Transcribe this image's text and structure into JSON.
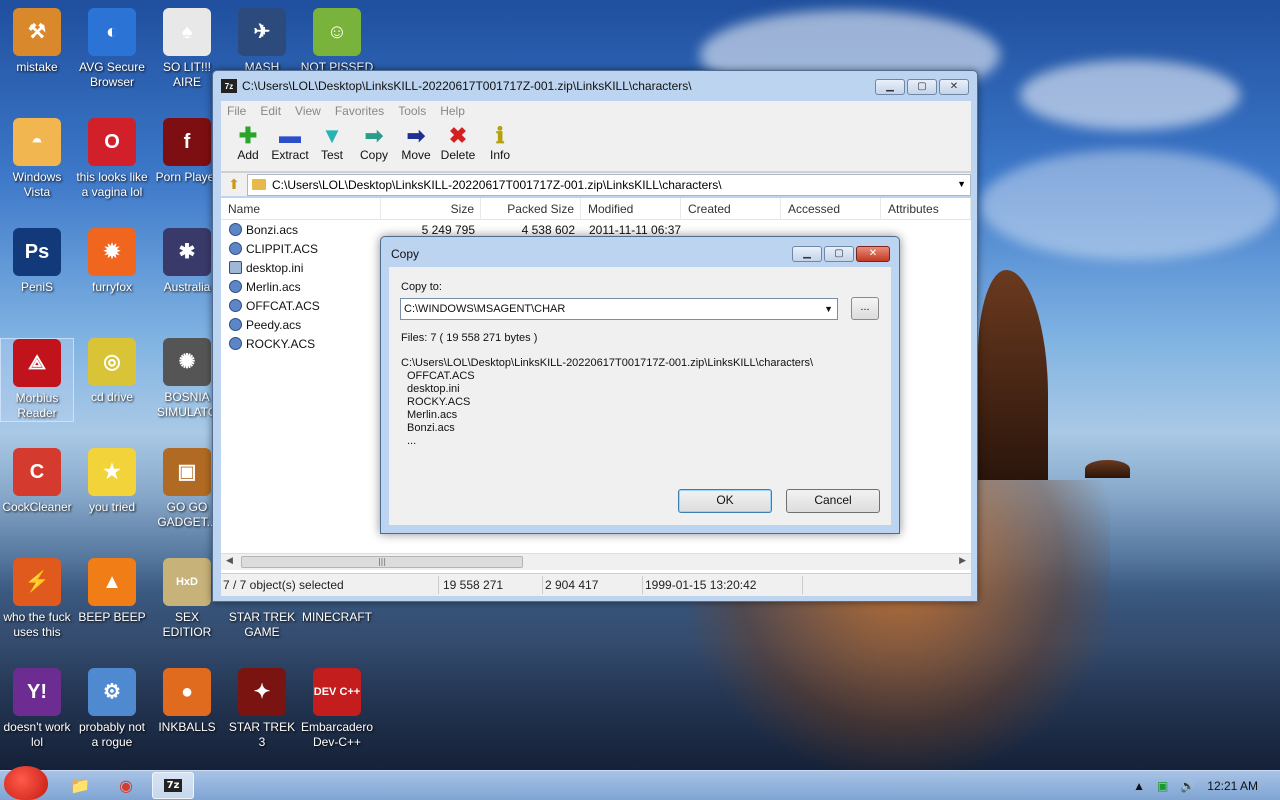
{
  "desktop": {
    "icons": [
      {
        "label": "mistake",
        "glyph": "⚒",
        "color": "#d9892c"
      },
      {
        "label": "AVG Secure Browser",
        "glyph": "◐",
        "color": "#2b74d6"
      },
      {
        "label": "SO LIT!!! AIRE",
        "glyph": "♠",
        "color": "#e8e8e8"
      },
      {
        "label": "MASH",
        "glyph": "✈",
        "color": "#2c4a7c"
      },
      {
        "label": "NOT PISSED",
        "glyph": "☺",
        "color": "#79b33b"
      },
      {
        "label": "Windows Vista",
        "glyph": "◓",
        "color": "#f2b650"
      },
      {
        "label": "this looks like a vagina lol",
        "glyph": "O",
        "color": "#d1202a"
      },
      {
        "label": "Porn Player",
        "glyph": "f",
        "color": "#7d0f12"
      },
      {
        "label": "PeniS",
        "glyph": "Ps",
        "color": "#123a7a"
      },
      {
        "label": "furryfox",
        "glyph": "✹",
        "color": "#f0661e"
      },
      {
        "label": "Australia",
        "glyph": "✱",
        "color": "#3a3a6a"
      },
      {
        "label": "Morbius Reader",
        "glyph": "⟁",
        "color": "#c0131b"
      },
      {
        "label": "cd drive",
        "glyph": "◎",
        "color": "#d9c437"
      },
      {
        "label": "BOSNIA SIMULATO",
        "glyph": "✺",
        "color": "#555"
      },
      {
        "label": "CockCleaner",
        "glyph": "C",
        "color": "#d53a2e"
      },
      {
        "label": "you tried",
        "glyph": "★",
        "color": "#f2d33a"
      },
      {
        "label": "GO GO GADGET...",
        "glyph": "▣",
        "color": "#b06a23"
      },
      {
        "label": "who the fuck uses this",
        "glyph": "⚡",
        "color": "#e05a1e"
      },
      {
        "label": "BEEP BEEP",
        "glyph": "▲",
        "color": "#f07d16"
      },
      {
        "label": "SEX EDITIOR",
        "glyph": "HxD",
        "color": "#c7b27a"
      },
      {
        "label": "STAR TREK GAME",
        "glyph": "",
        "color": "transparent"
      },
      {
        "label": "MINECRAFT",
        "glyph": "",
        "color": "transparent"
      },
      {
        "label": "doesn't work lol",
        "glyph": "Y!",
        "color": "#6c2c91"
      },
      {
        "label": "probably not a rogue",
        "glyph": "⚙",
        "color": "#4f8ad0"
      },
      {
        "label": "INKBALLS",
        "glyph": "●",
        "color": "#e06a1e"
      },
      {
        "label": "STAR TREK 3",
        "glyph": "✦",
        "color": "#7a1410"
      },
      {
        "label": "Embarcadero Dev-C++",
        "glyph": "DEV C++",
        "color": "#c41d1d"
      }
    ]
  },
  "zipwin": {
    "title": "C:\\Users\\LOL\\Desktop\\LinksKILL-20220617T001717Z-001.zip\\LinksKILL\\characters\\",
    "logo": "7z",
    "menu": [
      "File",
      "Edit",
      "View",
      "Favorites",
      "Tools",
      "Help"
    ],
    "toolbar": [
      {
        "label": "Add",
        "glyph": "✚",
        "color": "#2aa52a"
      },
      {
        "label": "Extract",
        "glyph": "▬",
        "color": "#2a4fc9"
      },
      {
        "label": "Test",
        "glyph": "▼",
        "color": "#2ab3b3"
      },
      {
        "label": "Copy",
        "glyph": "➡",
        "color": "#2a9d8a"
      },
      {
        "label": "Move",
        "glyph": "➡",
        "color": "#1f2f8f"
      },
      {
        "label": "Delete",
        "glyph": "✖",
        "color": "#d42020"
      },
      {
        "label": "Info",
        "glyph": "ℹ",
        "color": "#b3a20c"
      }
    ],
    "address": "C:\\Users\\LOL\\Desktop\\LinksKILL-20220617T001717Z-001.zip\\LinksKILL\\characters\\",
    "columns": [
      "Name",
      "Size",
      "Packed Size",
      "Modified",
      "Created",
      "Accessed",
      "Attributes"
    ],
    "files": [
      {
        "name": "Bonzi.acs",
        "size": "5 249 795",
        "packed": "4 538 602",
        "modified": "2011-11-11 06:37",
        "type": "acs"
      },
      {
        "name": "CLIPPIT.ACS",
        "size": "",
        "packed": "",
        "modified": "",
        "type": "acs"
      },
      {
        "name": "desktop.ini",
        "size": "",
        "packed": "",
        "modified": "",
        "type": "ini"
      },
      {
        "name": "Merlin.acs",
        "size": "",
        "packed": "",
        "modified": "",
        "type": "acs"
      },
      {
        "name": "OFFCAT.ACS",
        "size": "",
        "packed": "",
        "modified": "",
        "type": "acs"
      },
      {
        "name": "Peedy.acs",
        "size": "",
        "packed": "",
        "modified": "",
        "type": "acs"
      },
      {
        "name": "ROCKY.ACS",
        "size": "",
        "packed": "",
        "modified": "",
        "type": "acs"
      }
    ],
    "status": {
      "selected": "7 / 7 object(s) selected",
      "size": "19 558 271",
      "packed": "2 904 417",
      "date": "1999-01-15 13:20:42"
    }
  },
  "dialog": {
    "title": "Copy",
    "copy_to_label": "Copy to:",
    "copy_to_value": "C:\\WINDOWS\\MSAGENT\\CHAR",
    "browse_label": "...",
    "files_info": "Files: 7    ( 19 558 271 bytes )",
    "source_path": "C:\\Users\\LOL\\Desktop\\LinksKILL-20220617T001717Z-001.zip\\LinksKILL\\characters\\",
    "file_list": [
      "OFFCAT.ACS",
      "desktop.ini",
      "ROCKY.ACS",
      "Merlin.acs",
      "Bonzi.acs",
      "..."
    ],
    "ok_label": "OK",
    "cancel_label": "Cancel"
  },
  "taskbar": {
    "clock": "12:21 AM",
    "items": [
      {
        "name": "explorer",
        "glyph": "📁"
      },
      {
        "name": "chrome",
        "glyph": "◉"
      },
      {
        "name": "7zip",
        "glyph": "7z"
      }
    ]
  }
}
